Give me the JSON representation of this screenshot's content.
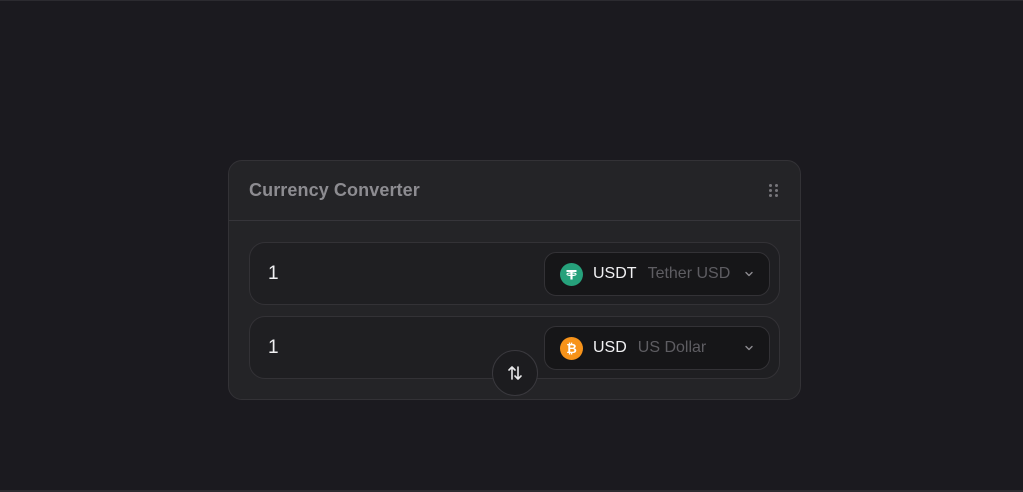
{
  "widget": {
    "title": "Currency Converter",
    "drag_icon": "drag-handle-icon",
    "swap_icon": "swap-vertical-icon"
  },
  "from": {
    "amount": "1",
    "currency_code": "USDT",
    "currency_name": "Tether USD",
    "coin_icon": "tether-icon",
    "coin_symbol": "₮",
    "coin_color": "#26a17b"
  },
  "to": {
    "amount": "1",
    "currency_code": "USD",
    "currency_name": "US Dollar",
    "coin_icon": "bitcoin-icon",
    "coin_symbol": "₿",
    "coin_color": "#f7931a"
  },
  "colors": {
    "background": "#1b1a1f",
    "card": "#242427",
    "text_primary": "#f1f1f3",
    "text_muted": "#5e5d62"
  }
}
